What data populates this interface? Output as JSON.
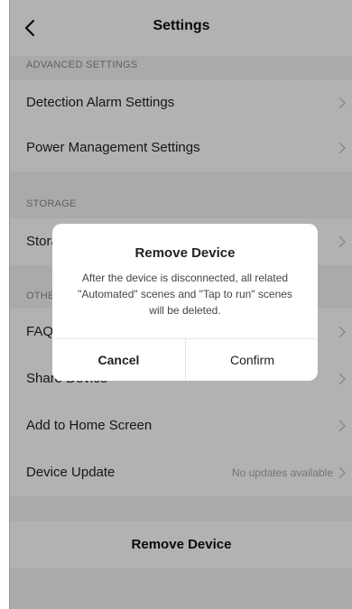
{
  "header": {
    "title": "Settings",
    "back_icon": "chevron-left-icon"
  },
  "sections": {
    "advanced": {
      "title": "ADVANCED SETTINGS",
      "items": [
        {
          "label": "Detection Alarm Settings"
        },
        {
          "label": "Power Management Settings"
        }
      ]
    },
    "storage": {
      "title": "STORAGE",
      "items": [
        {
          "label": "Storage"
        }
      ]
    },
    "other": {
      "title": "OTHER",
      "items": [
        {
          "label": "FAQ"
        },
        {
          "label": "Share Device"
        },
        {
          "label": "Add to Home Screen"
        },
        {
          "label": "Device Update",
          "value": "No updates available"
        }
      ]
    }
  },
  "remove_device": {
    "label": "Remove Device"
  },
  "dialog": {
    "title": "Remove Device",
    "message": "After the device is disconnected, all related \"Automated\" scenes and \"Tap to run\" scenes will be deleted.",
    "cancel_label": "Cancel",
    "confirm_label": "Confirm"
  },
  "colors": {
    "background": "#f4f4f4",
    "row_background": "#ffffff",
    "overlay": "rgba(0,0,0,0.30)",
    "secondary_text": "#a8a8a8"
  }
}
